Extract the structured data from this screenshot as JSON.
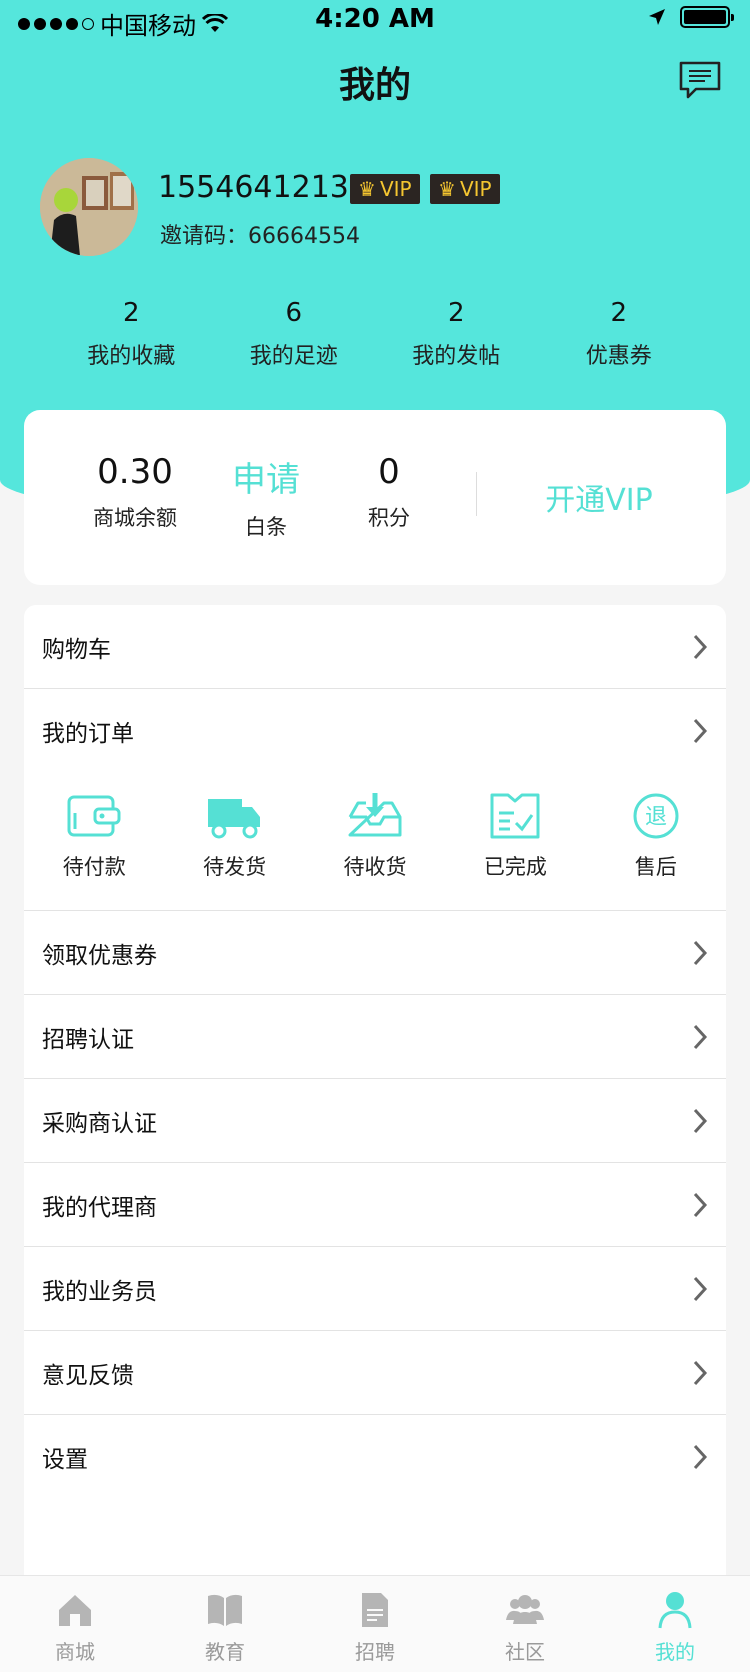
{
  "status_bar": {
    "carrier": "中国移动",
    "time": "4:20 AM"
  },
  "header": {
    "title": "我的",
    "message_icon": "message-icon"
  },
  "profile": {
    "phone": "15546412132",
    "vip_badges": [
      "VIP",
      "VIP"
    ],
    "invite_label": "邀请码：",
    "invite_code": "66664554"
  },
  "stats": [
    {
      "value": "2",
      "label": "我的收藏"
    },
    {
      "value": "6",
      "label": "我的足迹"
    },
    {
      "value": "2",
      "label": "我的发帖"
    },
    {
      "value": "2",
      "label": "优惠券"
    }
  ],
  "balance": {
    "mall_balance_value": "0.30",
    "mall_balance_label": "商城余额",
    "credit_value": "申请",
    "credit_label": "白条",
    "points_value": "0",
    "points_label": "积分",
    "open_vip": "开通VIP"
  },
  "menu": {
    "cart": "购物车",
    "orders": "我的订单",
    "order_states": [
      {
        "label": "待付款",
        "icon": "wallet-icon"
      },
      {
        "label": "待发货",
        "icon": "truck-icon"
      },
      {
        "label": "待收货",
        "icon": "inbox-icon"
      },
      {
        "label": "已完成",
        "icon": "completed-icon"
      },
      {
        "label": "售后",
        "icon": "refund-icon",
        "glyph": "退"
      }
    ],
    "items": [
      "领取优惠券",
      "招聘认证",
      "采购商认证",
      "我的代理商",
      "我的业务员",
      "意见反馈",
      "设置"
    ]
  },
  "tabbar": [
    {
      "label": "商城",
      "icon": "home-icon",
      "active": false
    },
    {
      "label": "教育",
      "icon": "book-icon",
      "active": false
    },
    {
      "label": "招聘",
      "icon": "document-icon",
      "active": false
    },
    {
      "label": "社区",
      "icon": "people-icon",
      "active": false
    },
    {
      "label": "我的",
      "icon": "user-icon",
      "active": true
    }
  ],
  "colors": {
    "accent": "#55e6dc",
    "accent_text": "#55e0d4",
    "vip_bg": "#2b2522",
    "vip_text": "#f5c630"
  }
}
